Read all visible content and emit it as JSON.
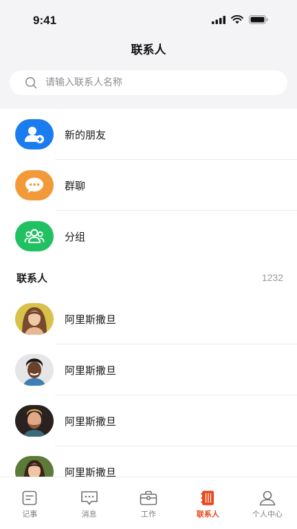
{
  "status_bar": {
    "time": "9:41"
  },
  "nav": {
    "title": "联系人"
  },
  "search": {
    "placeholder": "请输入联系人名称"
  },
  "entries": [
    {
      "label": "新的朋友",
      "icon": "add-user-icon",
      "color": "#1b7cf0"
    },
    {
      "label": "群聊",
      "icon": "chat-bubble-icon",
      "color": "#f29a3a"
    },
    {
      "label": "分组",
      "icon": "group-icon",
      "color": "#21c062"
    }
  ],
  "contacts_section": {
    "title": "联系人",
    "count": "1232"
  },
  "contacts": [
    {
      "name": "阿里斯撒旦"
    },
    {
      "name": "阿里斯撒旦"
    },
    {
      "name": "阿里斯撒旦"
    },
    {
      "name": "阿里斯撒旦"
    }
  ],
  "tabbar": {
    "items": [
      {
        "label": "记事",
        "icon": "note-icon",
        "active": false
      },
      {
        "label": "消息",
        "icon": "message-icon",
        "active": false
      },
      {
        "label": "工作",
        "icon": "briefcase-icon",
        "active": false
      },
      {
        "label": "联系人",
        "icon": "contacts-book-icon",
        "active": true
      },
      {
        "label": "个人中心",
        "icon": "profile-icon",
        "active": false
      }
    ]
  },
  "colors": {
    "accent": "#e64a1e",
    "background": "#f4f4f6"
  }
}
